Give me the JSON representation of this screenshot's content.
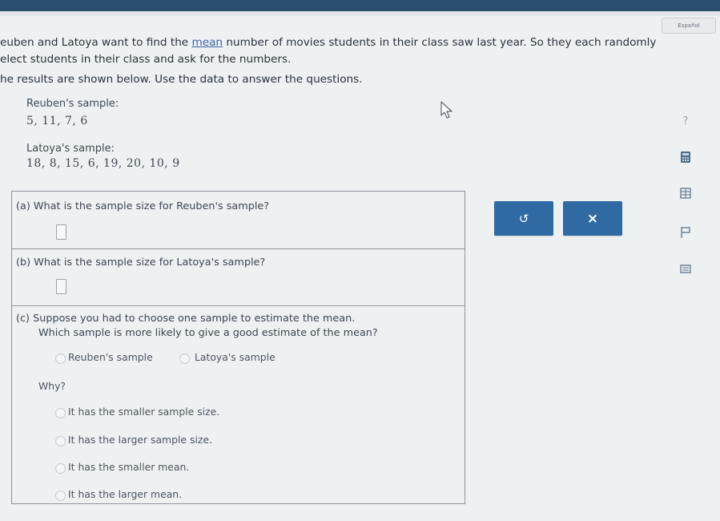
{
  "header": {
    "status_chip": "Español"
  },
  "intro": {
    "line1_before": "euben and Latoya want to find the ",
    "line1_link": "mean",
    "line1_after": " number of movies students in their class saw last year. So they each randomly",
    "line2": "elect students in their class and ask for the numbers.",
    "instructions": "he results are shown below. Use the data to answer the questions."
  },
  "samples": {
    "reuben_label": "Reuben's sample:",
    "reuben_values": "5, 11, 7, 6",
    "latoya_label": "Latoya's sample:",
    "latoya_values": "18, 8, 15, 6, 19, 20, 10, 9"
  },
  "questions": {
    "a_text": "(a)  What is the sample size for Reuben's sample?",
    "b_text": "(b)  What is the sample size for Latoya's sample?",
    "c_line1": "(c)  Suppose you had to choose one sample to estimate the mean.",
    "c_line2": "Which sample is more likely to give a good estimate of the mean?",
    "choice_reuben": "Reuben's sample",
    "choice_latoya": "Latoya's sample",
    "why_label": "Why?",
    "why_options": [
      "It has the smaller sample size.",
      "It has the larger sample size.",
      "It has the smaller mean.",
      "It has the larger mean."
    ]
  },
  "buttons": {
    "undo_symbol": "↺",
    "clear_symbol": "×"
  },
  "colors": {
    "accent": "#2f6aa3",
    "topbar": "#2a4f6e",
    "link": "#3a63a8"
  },
  "icons": [
    "question-icon",
    "calculator-icon",
    "data-table-icon",
    "flag-icon",
    "notes-icon"
  ]
}
